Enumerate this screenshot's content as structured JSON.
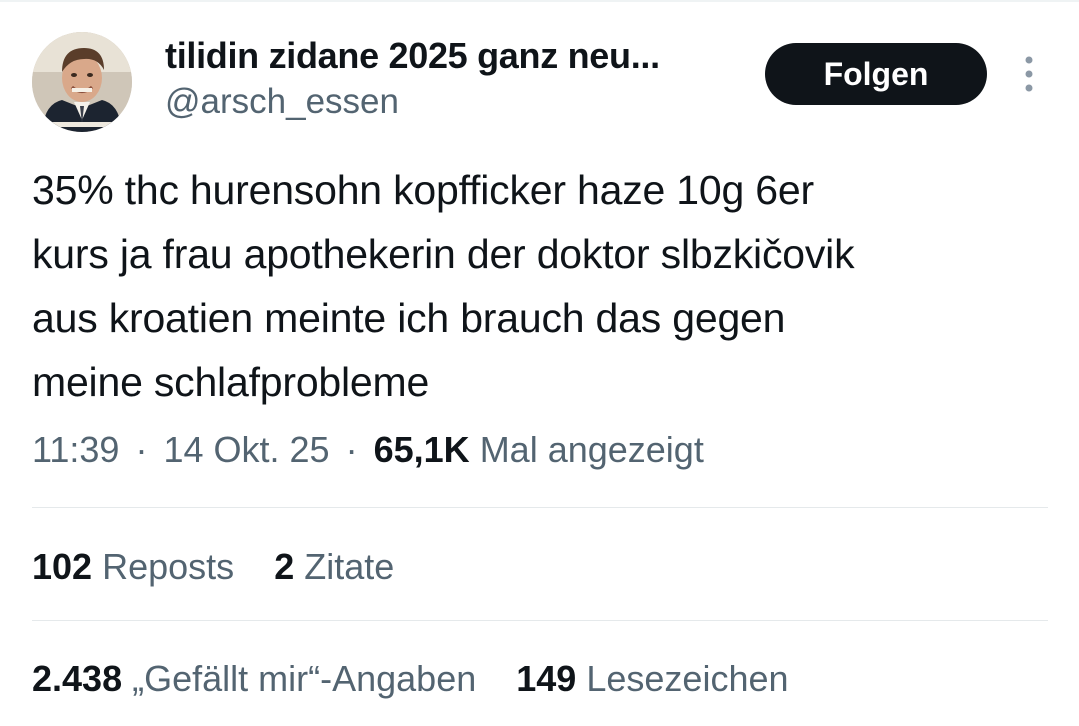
{
  "user": {
    "display_name": "tilidin zidane 2025 ganz neu...",
    "handle": "@arsch_essen"
  },
  "follow_button": {
    "label": "Folgen"
  },
  "more_icon": "more-vertical-icon",
  "tweet": {
    "lines": [
      "35% thc hurensohn kopfficker haze 10g 6er",
      "kurs ja frau apothekerin der doktor slbzkičovik",
      "aus kroatien meinte ich brauch das gegen",
      "meine schlafprobleme"
    ]
  },
  "meta": {
    "time": "11:39",
    "separator": "·",
    "date": "14 Okt. 25",
    "views_count": "65,1K",
    "views_label": "Mal angezeigt"
  },
  "stats": {
    "reposts_count": "102",
    "reposts_label": "Reposts",
    "quotes_count": "2",
    "quotes_label": "Zitate",
    "likes_count": "2.438",
    "likes_label": "„Gefällt mir“-Angaben",
    "bookmarks_count": "149",
    "bookmarks_label": "Lesezeichen"
  },
  "colors": {
    "text_primary": "#0f1419",
    "text_secondary": "#536471",
    "button_bg": "#0f1419",
    "divider": "#e5e9eb"
  }
}
